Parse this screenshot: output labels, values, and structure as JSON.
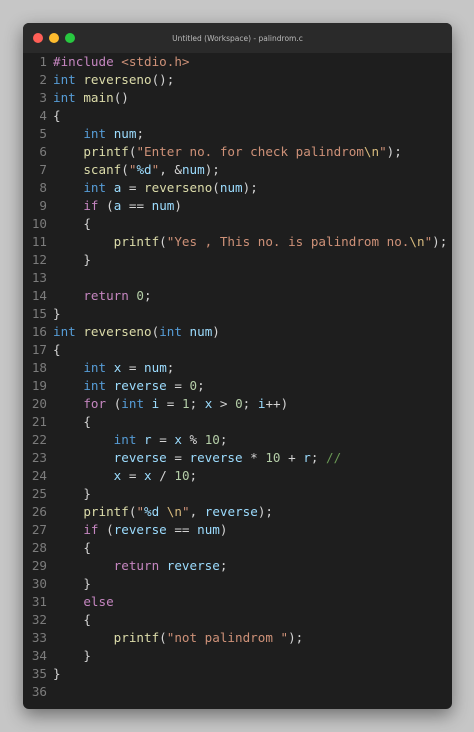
{
  "window": {
    "title": "Untitled (Workspace) - palindrom.c",
    "traffic_lights": {
      "close_color": "#ff5f57",
      "minimize_color": "#febc2e",
      "zoom_color": "#28c840"
    }
  },
  "colors": {
    "keyword": "#569cd6",
    "control": "#c586c0",
    "function": "#dcdcaa",
    "string": "#ce9178",
    "number": "#b5cea8",
    "variable": "#9cdcfe",
    "comment": "#6a9955",
    "background": "#1e1e1e"
  },
  "lines": [
    [
      [
        "pp",
        "#include "
      ],
      [
        "inc",
        "<stdio.h>"
      ]
    ],
    [
      [
        "kw",
        "int "
      ],
      [
        "fn",
        "reverseno"
      ],
      [
        "plain",
        "();"
      ]
    ],
    [
      [
        "kw",
        "int "
      ],
      [
        "fn",
        "main"
      ],
      [
        "plain",
        "()"
      ]
    ],
    [
      [
        "plain",
        "{"
      ]
    ],
    [
      [
        "plain",
        "    "
      ],
      [
        "kw",
        "int "
      ],
      [
        "var",
        "num"
      ],
      [
        "plain",
        ";"
      ]
    ],
    [
      [
        "plain",
        "    "
      ],
      [
        "fn",
        "printf"
      ],
      [
        "plain",
        "("
      ],
      [
        "str",
        "\"Enter no. for check palindrom"
      ],
      [
        "esc",
        "\\n"
      ],
      [
        "str",
        "\""
      ],
      [
        "plain",
        ");"
      ]
    ],
    [
      [
        "plain",
        "    "
      ],
      [
        "fn",
        "scanf"
      ],
      [
        "plain",
        "("
      ],
      [
        "str",
        "\""
      ],
      [
        "fmt",
        "%d"
      ],
      [
        "str",
        "\""
      ],
      [
        "plain",
        ", &"
      ],
      [
        "var",
        "num"
      ],
      [
        "plain",
        ");"
      ]
    ],
    [
      [
        "plain",
        "    "
      ],
      [
        "kw",
        "int "
      ],
      [
        "var",
        "a"
      ],
      [
        "plain",
        " = "
      ],
      [
        "fn",
        "reverseno"
      ],
      [
        "plain",
        "("
      ],
      [
        "var",
        "num"
      ],
      [
        "plain",
        ");"
      ]
    ],
    [
      [
        "plain",
        "    "
      ],
      [
        "ctrl",
        "if "
      ],
      [
        "plain",
        "("
      ],
      [
        "var",
        "a"
      ],
      [
        "plain",
        " == "
      ],
      [
        "var",
        "num"
      ],
      [
        "plain",
        ")"
      ]
    ],
    [
      [
        "plain",
        "    {"
      ]
    ],
    [
      [
        "plain",
        "        "
      ],
      [
        "fn",
        "printf"
      ],
      [
        "plain",
        "("
      ],
      [
        "str",
        "\"Yes , This no. is palindrom no."
      ],
      [
        "esc",
        "\\n"
      ],
      [
        "str",
        "\""
      ],
      [
        "plain",
        ");"
      ]
    ],
    [
      [
        "plain",
        "    }"
      ]
    ],
    [],
    [
      [
        "plain",
        "    "
      ],
      [
        "ctrl",
        "return "
      ],
      [
        "num",
        "0"
      ],
      [
        "plain",
        ";"
      ]
    ],
    [
      [
        "plain",
        "}"
      ]
    ],
    [
      [
        "kw",
        "int "
      ],
      [
        "fn",
        "reverseno"
      ],
      [
        "plain",
        "("
      ],
      [
        "kw",
        "int "
      ],
      [
        "var",
        "num"
      ],
      [
        "plain",
        ")"
      ]
    ],
    [
      [
        "plain",
        "{"
      ]
    ],
    [
      [
        "plain",
        "    "
      ],
      [
        "kw",
        "int "
      ],
      [
        "var",
        "x"
      ],
      [
        "plain",
        " = "
      ],
      [
        "var",
        "num"
      ],
      [
        "plain",
        ";"
      ]
    ],
    [
      [
        "plain",
        "    "
      ],
      [
        "kw",
        "int "
      ],
      [
        "var",
        "reverse"
      ],
      [
        "plain",
        " = "
      ],
      [
        "num",
        "0"
      ],
      [
        "plain",
        ";"
      ]
    ],
    [
      [
        "plain",
        "    "
      ],
      [
        "ctrl",
        "for "
      ],
      [
        "plain",
        "("
      ],
      [
        "kw",
        "int "
      ],
      [
        "var",
        "i"
      ],
      [
        "plain",
        " = "
      ],
      [
        "num",
        "1"
      ],
      [
        "plain",
        "; "
      ],
      [
        "var",
        "x"
      ],
      [
        "plain",
        " > "
      ],
      [
        "num",
        "0"
      ],
      [
        "plain",
        "; "
      ],
      [
        "var",
        "i"
      ],
      [
        "plain",
        "++)"
      ]
    ],
    [
      [
        "plain",
        "    {"
      ]
    ],
    [
      [
        "plain",
        "        "
      ],
      [
        "kw",
        "int "
      ],
      [
        "var",
        "r"
      ],
      [
        "plain",
        " = "
      ],
      [
        "var",
        "x"
      ],
      [
        "plain",
        " % "
      ],
      [
        "num",
        "10"
      ],
      [
        "plain",
        ";"
      ]
    ],
    [
      [
        "plain",
        "        "
      ],
      [
        "var",
        "reverse"
      ],
      [
        "plain",
        " = "
      ],
      [
        "var",
        "reverse"
      ],
      [
        "plain",
        " * "
      ],
      [
        "num",
        "10"
      ],
      [
        "plain",
        " + "
      ],
      [
        "var",
        "r"
      ],
      [
        "plain",
        "; "
      ],
      [
        "cmt",
        "//"
      ]
    ],
    [
      [
        "plain",
        "        "
      ],
      [
        "var",
        "x"
      ],
      [
        "plain",
        " = "
      ],
      [
        "var",
        "x"
      ],
      [
        "plain",
        " / "
      ],
      [
        "num",
        "10"
      ],
      [
        "plain",
        ";"
      ]
    ],
    [
      [
        "plain",
        "    }"
      ]
    ],
    [
      [
        "plain",
        "    "
      ],
      [
        "fn",
        "printf"
      ],
      [
        "plain",
        "("
      ],
      [
        "str",
        "\""
      ],
      [
        "fmt",
        "%d"
      ],
      [
        "str",
        " "
      ],
      [
        "esc",
        "\\n"
      ],
      [
        "str",
        "\""
      ],
      [
        "plain",
        ", "
      ],
      [
        "var",
        "reverse"
      ],
      [
        "plain",
        ");"
      ]
    ],
    [
      [
        "plain",
        "    "
      ],
      [
        "ctrl",
        "if "
      ],
      [
        "plain",
        "("
      ],
      [
        "var",
        "reverse"
      ],
      [
        "plain",
        " == "
      ],
      [
        "var",
        "num"
      ],
      [
        "plain",
        ")"
      ]
    ],
    [
      [
        "plain",
        "    {"
      ]
    ],
    [
      [
        "plain",
        "        "
      ],
      [
        "ctrl",
        "return "
      ],
      [
        "var",
        "reverse"
      ],
      [
        "plain",
        ";"
      ]
    ],
    [
      [
        "plain",
        "    }"
      ]
    ],
    [
      [
        "plain",
        "    "
      ],
      [
        "ctrl",
        "else"
      ]
    ],
    [
      [
        "plain",
        "    {"
      ]
    ],
    [
      [
        "plain",
        "        "
      ],
      [
        "fn",
        "printf"
      ],
      [
        "plain",
        "("
      ],
      [
        "str",
        "\"not palindrom \""
      ],
      [
        "plain",
        ");"
      ]
    ],
    [
      [
        "plain",
        "    }"
      ]
    ],
    [
      [
        "plain",
        "}"
      ]
    ],
    []
  ]
}
